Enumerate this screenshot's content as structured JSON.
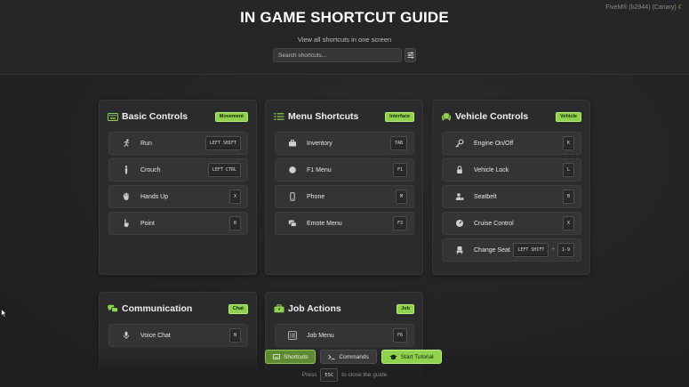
{
  "header": {
    "title": "IN GAME SHORTCUT GUIDE",
    "subtitle": "View all shortcuts in one screen",
    "build_tag": "FiveM® (b2944) (Canary)",
    "search_placeholder": "Search shortcuts..."
  },
  "cards": [
    {
      "title": "Basic Controls",
      "badge": "Movement",
      "icon": "keyboard-icon",
      "items": [
        {
          "label": "Run",
          "icon": "running-icon",
          "keys": [
            "LEFT SHIFT"
          ]
        },
        {
          "label": "Crouch",
          "icon": "person-icon",
          "keys": [
            "LEFT CTRL"
          ]
        },
        {
          "label": "Hands Up",
          "icon": "hand-icon",
          "keys": [
            "X"
          ]
        },
        {
          "label": "Point",
          "icon": "pointing-hand-icon",
          "keys": [
            "B"
          ]
        }
      ]
    },
    {
      "title": "Menu Shortcuts",
      "badge": "Interface",
      "icon": "list-icon",
      "items": [
        {
          "label": "Inventory",
          "icon": "briefcase-icon",
          "keys": [
            "TAB"
          ]
        },
        {
          "label": "F1 Menu",
          "icon": "circle-icon",
          "keys": [
            "F1"
          ]
        },
        {
          "label": "Phone",
          "icon": "phone-icon",
          "keys": [
            "M"
          ]
        },
        {
          "label": "Emote Menu",
          "icon": "emote-icon",
          "keys": [
            "F3"
          ]
        }
      ]
    },
    {
      "title": "Vehicle Controls",
      "badge": "Vehicle",
      "icon": "car-icon",
      "items": [
        {
          "label": "Engine On/Off",
          "icon": "key-icon",
          "keys": [
            "K"
          ]
        },
        {
          "label": "Vehicle Lock",
          "icon": "lock-icon",
          "keys": [
            "L"
          ]
        },
        {
          "label": "Seatbelt",
          "icon": "user-lock-icon",
          "keys": [
            "B"
          ]
        },
        {
          "label": "Cruise Control",
          "icon": "gauge-icon",
          "keys": [
            "X"
          ]
        },
        {
          "label": "Change Seat",
          "icon": "seat-icon",
          "keys": [
            "LEFT SHIFT",
            "1-9"
          ],
          "separator": "+"
        }
      ]
    },
    {
      "title": "Communication",
      "badge": "Chat",
      "icon": "chat-icon",
      "items": [
        {
          "label": "Voice Chat",
          "icon": "microphone-icon",
          "keys": [
            "N"
          ]
        }
      ]
    },
    {
      "title": "Job Actions",
      "badge": "Job",
      "icon": "toolbox-icon",
      "items": [
        {
          "label": "Job Menu",
          "icon": "menu-list-icon",
          "keys": [
            "F6"
          ]
        }
      ]
    }
  ],
  "bottom_bar": {
    "shortcuts_label": "Shortcuts",
    "commands_label": "Commands",
    "tutorial_label": "Start Tutorial",
    "hint_before": "Press",
    "hint_key": "ESC",
    "hint_after": "to close the guide"
  },
  "colors": {
    "accent": "#8ed24e",
    "background": "#232325",
    "card": "#2b2b2d"
  }
}
